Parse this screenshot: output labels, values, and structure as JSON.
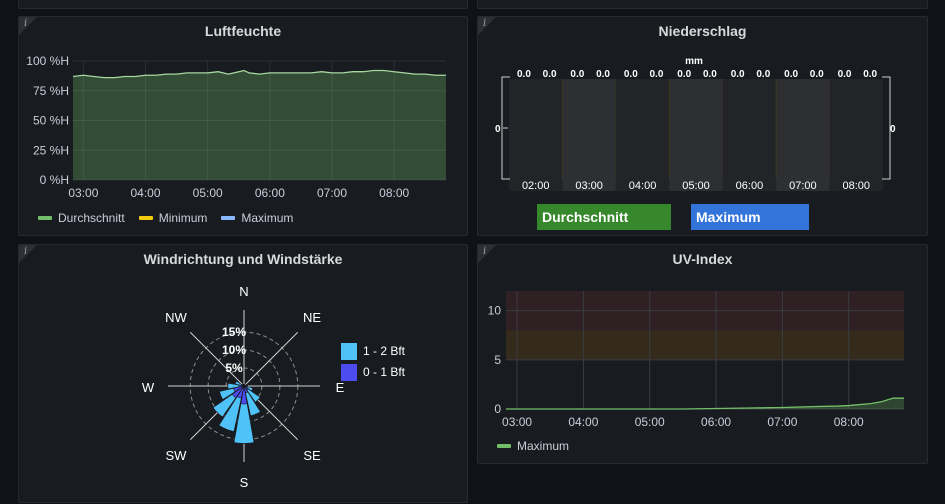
{
  "panels": {
    "top_left_stub": {},
    "top_right_stub": {},
    "luftfeuchte": {
      "title": "Luftfeuchte",
      "legend": [
        {
          "label": "Durchschnitt",
          "color": "#73bf69"
        },
        {
          "label": "Minimum",
          "color": "#f2cc0c"
        },
        {
          "label": "Maximum",
          "color": "#8ab8ff"
        }
      ]
    },
    "niederschlag": {
      "title": "Niederschlag",
      "legend": [
        {
          "label": "Durchschnitt",
          "color": "#37872d"
        },
        {
          "label": "Maximum",
          "color": "#3274d9"
        }
      ]
    },
    "wind": {
      "title": "Windrichtung und Windstärke",
      "legend": [
        {
          "label": "1 - 2 Bft",
          "color": "#4fc3f7"
        },
        {
          "label": "0 - 1 Bft",
          "color": "#4c4cf0"
        }
      ]
    },
    "uv": {
      "title": "UV-Index",
      "legend": [
        {
          "label": "Maximum",
          "color": "#73bf69"
        }
      ]
    }
  },
  "chart_data": [
    {
      "type": "area",
      "title": "Luftfeuchte",
      "x": [
        "02:50",
        "03:00",
        "03:10",
        "03:20",
        "03:30",
        "03:40",
        "03:50",
        "04:00",
        "04:10",
        "04:20",
        "04:30",
        "04:40",
        "04:50",
        "05:00",
        "05:10",
        "05:20",
        "05:30",
        "05:35",
        "05:40",
        "05:50",
        "06:00",
        "06:10",
        "06:20",
        "06:30",
        "06:40",
        "06:50",
        "07:00",
        "07:10",
        "07:20",
        "07:30",
        "07:40",
        "07:50",
        "08:00",
        "08:10",
        "08:20",
        "08:30",
        "08:40",
        "08:50"
      ],
      "series": [
        {
          "name": "Durchschnitt",
          "color": "#73bf69",
          "values": [
            87,
            88,
            87,
            86,
            86,
            87,
            87,
            88,
            88,
            89,
            89,
            90,
            90,
            90,
            91,
            89,
            91,
            92,
            90,
            89,
            90,
            90,
            90,
            90,
            90,
            91,
            90,
            90,
            91,
            91,
            92,
            92,
            91,
            90,
            89,
            89,
            88,
            88
          ]
        }
      ],
      "xticks": [
        "03:00",
        "04:00",
        "05:00",
        "06:00",
        "07:00",
        "08:00"
      ],
      "yticks": [
        "0 %H",
        "25 %H",
        "50 %H",
        "75 %H",
        "100 %H"
      ],
      "ylim": [
        0,
        100
      ],
      "grid": true
    },
    {
      "type": "bar",
      "title": "Niederschlag",
      "unit": "mm",
      "categories": [
        "02:00",
        "03:00",
        "04:00",
        "05:00",
        "06:00",
        "07:00",
        "08:00"
      ],
      "series": [
        {
          "name": "Durchschnitt",
          "values": [
            0.0,
            0.0,
            0.0,
            0.0,
            0.0,
            0.0,
            0.0
          ]
        },
        {
          "name": "Maximum",
          "values": [
            0.0,
            0.0,
            0.0,
            0.0,
            0.0,
            0.0,
            0.0
          ]
        }
      ],
      "value_labels": [
        "0.0",
        "0.0",
        "0.0",
        "0.0",
        "0.0",
        "0.0",
        "0.0",
        "0.0",
        "0.0",
        "0.0",
        "0.0",
        "0.0",
        "0.0",
        "0.0"
      ],
      "yleft_label": "0",
      "yright_label": "0"
    },
    {
      "type": "polar-bar",
      "title": "Windrichtung und Windstärke",
      "directions": [
        "N",
        "NE",
        "E",
        "SE",
        "S",
        "SW",
        "W",
        "NW"
      ],
      "angle_deg": [
        0,
        22.5,
        45,
        67.5,
        90,
        112.5,
        135,
        157.5,
        180,
        202.5,
        225,
        247.5,
        270,
        292.5,
        315,
        337.5
      ],
      "radial_ticks": [
        "5%",
        "10%",
        "15%"
      ],
      "rmax": 17,
      "series": [
        {
          "name": "0 - 1 Bft",
          "values": [
            0.3,
            0.3,
            0.3,
            0.5,
            0.8,
            1.0,
            1.5,
            2.0,
            5.0,
            3.5,
            4.0,
            3.0,
            1.5,
            0.8,
            0.3,
            0.3
          ]
        },
        {
          "name": "1 - 2 Bft",
          "values": [
            0.5,
            0.4,
            0.4,
            1.0,
            1.0,
            2.5,
            5.5,
            8.5,
            16.0,
            13.0,
            10.5,
            7.0,
            4.5,
            2.5,
            0.6,
            0.5
          ]
        }
      ]
    },
    {
      "type": "line",
      "title": "UV-Index",
      "x": [
        "02:50",
        "03:00",
        "03:30",
        "04:00",
        "04:30",
        "05:00",
        "05:30",
        "06:00",
        "06:30",
        "07:00",
        "07:30",
        "07:50",
        "08:00",
        "08:10",
        "08:20",
        "08:30",
        "08:40",
        "08:50"
      ],
      "series": [
        {
          "name": "Maximum",
          "color": "#73bf69",
          "values": [
            0,
            0,
            0,
            0,
            0,
            0,
            0,
            0.05,
            0.1,
            0.15,
            0.25,
            0.3,
            0.35,
            0.45,
            0.55,
            0.75,
            1.1,
            1.1
          ]
        }
      ],
      "xticks": [
        "03:00",
        "04:00",
        "05:00",
        "06:00",
        "07:00",
        "08:00"
      ],
      "yticks": [
        "0",
        "5",
        "10"
      ],
      "ylim": [
        0,
        12
      ],
      "thresholds": [
        {
          "from": 5,
          "to": 8,
          "color": "#6b4a1a"
        },
        {
          "from": 8,
          "to": 12,
          "color": "#5a2a2a"
        }
      ]
    }
  ]
}
